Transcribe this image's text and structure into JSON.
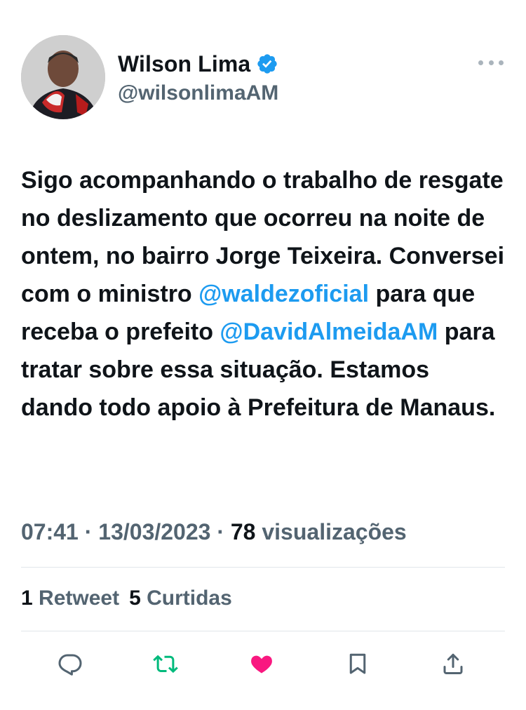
{
  "author": {
    "display_name": "Wilson Lima",
    "handle": "@wilsonlimaAM",
    "verified": true,
    "avatar_icon": "profile-photo"
  },
  "tweet": {
    "segments": [
      {
        "type": "text",
        "value": "Sigo acompanhando o trabalho de resgate no deslizamento que ocorreu na noite de ontem, no bairro Jorge Teixeira. Conversei com o ministro "
      },
      {
        "type": "mention",
        "value": "@waldezoficial"
      },
      {
        "type": "text",
        "value": " para que receba o prefeito "
      },
      {
        "type": "mention",
        "value": "@DavidAlmeidaAM"
      },
      {
        "type": "text",
        "value": " para tratar sobre essa situação. Estamos dando todo apoio à Prefeitura de Manaus."
      }
    ]
  },
  "meta": {
    "time": "07:41",
    "separator": "·",
    "date": "13/03/2023",
    "views_count": "78",
    "views_label": "visualizações"
  },
  "stats": {
    "retweets_count": "1",
    "retweets_label": "Retweet",
    "likes_count": "5",
    "likes_label": "Curtidas"
  },
  "actions": {
    "reply_icon": "reply-icon",
    "retweet_icon": "retweet-icon",
    "like_icon": "heart-icon",
    "bookmark_icon": "bookmark-icon",
    "share_icon": "share-icon",
    "retweet_color": "#00ba7c",
    "like_color": "#f91880",
    "mention_color": "#1d9bf0",
    "verified_color": "#1d9bf0"
  }
}
